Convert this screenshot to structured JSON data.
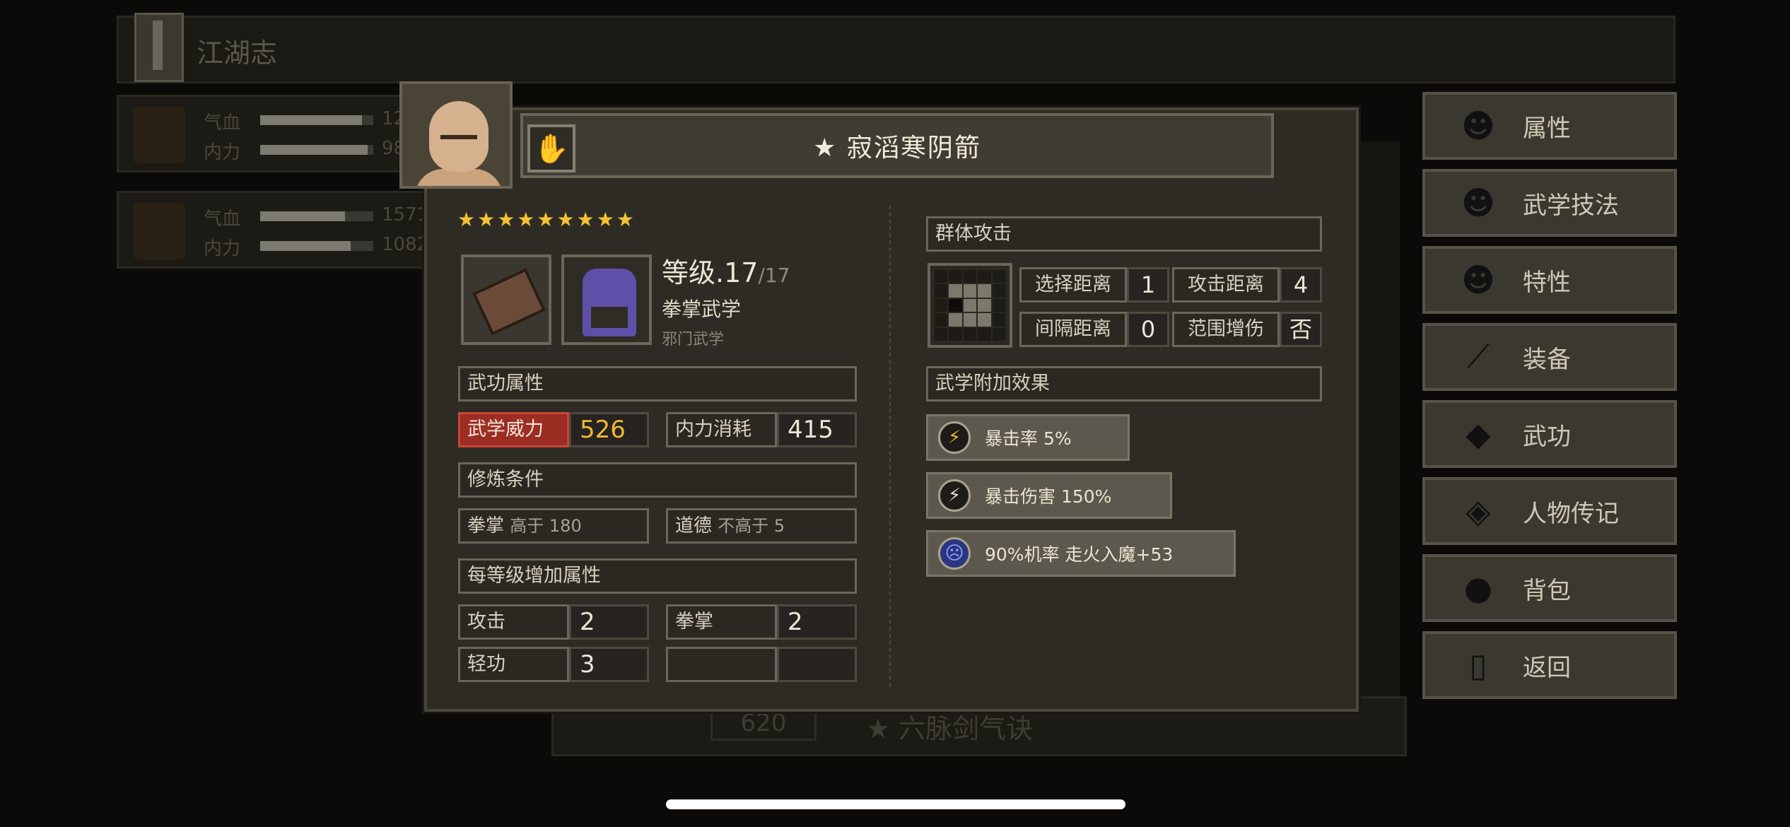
{
  "background": {
    "journal_title": "江湖志",
    "party": [
      {
        "hp_label": "气血",
        "mp_label": "内力",
        "hp_value": "12",
        "mp_value": "98",
        "hp_fill": 0.9,
        "mp_fill": 0.95
      },
      {
        "hp_label": "气血",
        "mp_label": "内力",
        "hp_value": "1571",
        "mp_value": "1082",
        "hp_fill": 0.75,
        "mp_fill": 0.8
      }
    ],
    "bottom_value": "620",
    "bottom_skill": "★ 六脉剑气诀"
  },
  "side_menu": [
    {
      "label": "属性",
      "icon": "person-icon"
    },
    {
      "label": "武学技法",
      "icon": "person-aura-icon"
    },
    {
      "label": "特性",
      "icon": "person-trait-icon"
    },
    {
      "label": "装备",
      "icon": "sword-icon"
    },
    {
      "label": "武功",
      "icon": "book-icon"
    },
    {
      "label": "人物传记",
      "icon": "scroll-icon"
    },
    {
      "label": "背包",
      "icon": "bag-icon"
    },
    {
      "label": "返回",
      "icon": "door-icon"
    }
  ],
  "skill": {
    "title": "★ 寂滔寒阴箭",
    "stars": 9,
    "star_max": 9,
    "level_label": "等级",
    "level": ".17",
    "level_max": "/17",
    "category": "拳掌武学",
    "sect": "邪门武学"
  },
  "attributes": {
    "header": "武功属性",
    "power_label": "武学威力",
    "power_value": "526",
    "cost_label": "内力消耗",
    "cost_value": "415"
  },
  "requirements": {
    "header": "修炼条件",
    "req1_label": "拳掌",
    "req1_value": "高于 180",
    "req2_label": "道德",
    "req2_value": "不高于 5"
  },
  "per_level": {
    "header": "每等级增加属性",
    "rows": [
      {
        "k1": "攻击",
        "v1": "2",
        "k2": "拳掌",
        "v2": "2"
      },
      {
        "k1": "轻功",
        "v1": "3",
        "k2": "",
        "v2": ""
      }
    ]
  },
  "targeting": {
    "type": "群体攻击",
    "select_range_label": "选择距离",
    "select_range": "1",
    "attack_range_label": "攻击距离",
    "attack_range": "4",
    "gap_label": "间隔距离",
    "gap": "0",
    "aoe_bonus_label": "范围增伤",
    "aoe_bonus": "否"
  },
  "effects": {
    "header": "武学附加效果",
    "items": [
      {
        "icon": "lightning-icon",
        "text": "暴击率 5%"
      },
      {
        "icon": "lightning-icon",
        "text": "暴击伤害 150%"
      },
      {
        "icon": "demon-face-icon",
        "text": "90%机率 走火入魔+53"
      }
    ]
  },
  "colors": {
    "power_badge": "#9c2d22",
    "power_value": "#f2b834",
    "star": "#f4c232"
  }
}
